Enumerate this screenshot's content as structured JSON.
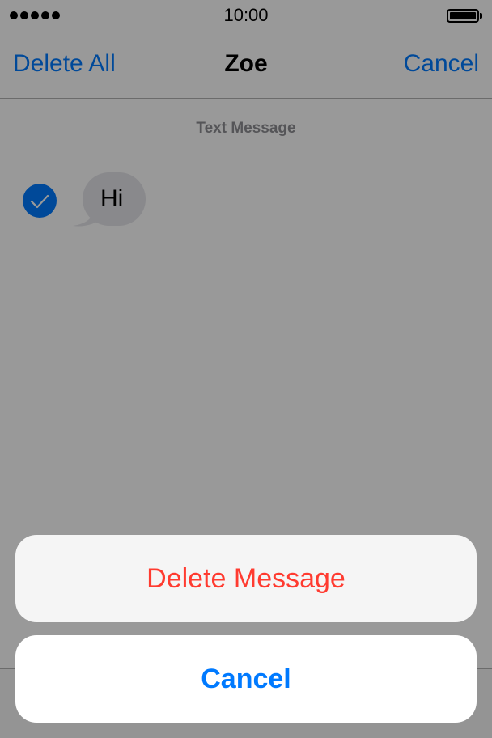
{
  "status_bar": {
    "signal_bars": 5,
    "time": "10:00",
    "battery_level": 1.0
  },
  "nav": {
    "left_label": "Delete All",
    "title": "Zoe",
    "right_label": "Cancel"
  },
  "conversation": {
    "header": "Text Message",
    "messages": [
      {
        "text": "Hi",
        "direction": "incoming",
        "selected": true
      }
    ]
  },
  "action_sheet": {
    "destructive_label": "Delete Message",
    "cancel_label": "Cancel"
  },
  "colors": {
    "accent": "#007aff",
    "destructive": "#ff3b30",
    "bubble_incoming": "#e5e5ea",
    "secondary_text": "#8e8e93"
  },
  "icons": {
    "check": "checkmark-circle-icon",
    "signal": "signal-dots-icon",
    "battery": "battery-icon"
  }
}
